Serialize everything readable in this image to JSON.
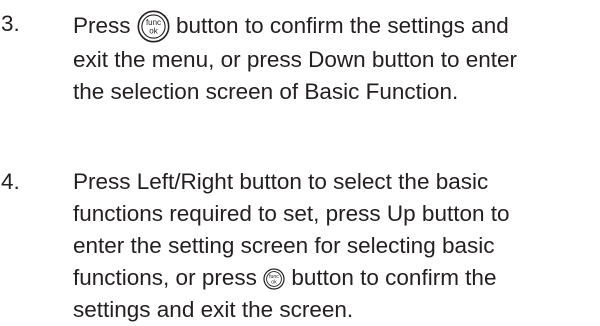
{
  "icons": {
    "func_ok_icon": "func-ok-button-icon",
    "icon_text_top": "func",
    "icon_text_bottom": "ok"
  },
  "steps": [
    {
      "number": "3.",
      "lines": [
        {
          "before_icon": "Press ",
          "after_icon": " button to confirm the settings and"
        },
        {
          "text": "exit the menu, or press Down button to enter"
        },
        {
          "text": "the selection screen of Basic Function."
        }
      ]
    },
    {
      "number": "4.",
      "lines": [
        {
          "text": "Press Left/Right button to select the basic"
        },
        {
          "text": "functions required to set, press Up button to"
        },
        {
          "text": "enter the setting screen for selecting basic"
        },
        {
          "before_icon": "functions, or press ",
          "after_icon": " button to confirm the"
        },
        {
          "text": "settings and exit the screen."
        }
      ]
    }
  ]
}
